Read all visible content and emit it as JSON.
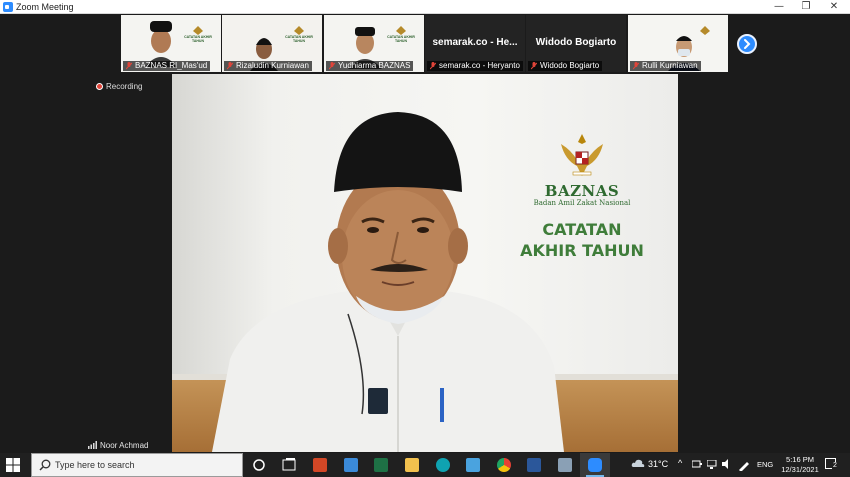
{
  "window": {
    "title": "Zoom Meeting",
    "controls": {
      "minimize": "—",
      "restore": "❐",
      "close": "✕"
    }
  },
  "thumbnails": [
    {
      "name": "BAZNAS RI_Mas'ud",
      "type": "video",
      "muted": true
    },
    {
      "name": "Rizaludin Kurniawan",
      "type": "video",
      "muted": true
    },
    {
      "name": "Yudhiarma BAZNAS",
      "type": "video",
      "muted": true
    },
    {
      "name": "semarak.co - Heryanto",
      "display_title": "semarak.co - He...",
      "type": "name-only",
      "muted": true
    },
    {
      "name": "Widodo Bogiarto",
      "display_title": "Widodo Bogiarto",
      "type": "name-only",
      "muted": true
    },
    {
      "name": "Rulli Kurniawan",
      "type": "video",
      "muted": true
    }
  ],
  "mini_logo": "CATATAN AKHIR TAHUN",
  "recording_label": "Recording",
  "main_video": {
    "speaker_name": "Noor Achmad",
    "backdrop": {
      "org": "BAZNAS",
      "org_full": "Badan Amil Zakat Nasional",
      "line1": "CATATAN",
      "line2": "AKHIR TAHUN"
    }
  },
  "taskbar": {
    "search_placeholder": "Type here to search",
    "weather": "31°C",
    "language": "ENG",
    "time": "5:16 PM",
    "date": "12/31/2021",
    "notification_count": "2",
    "tray_caret": "^",
    "apps": [
      {
        "name": "task-view",
        "color": "#ffffff"
      },
      {
        "name": "powerpoint",
        "color": "#d24726"
      },
      {
        "name": "downloads",
        "color": "#3b8ad8"
      },
      {
        "name": "excel",
        "color": "#1e7145"
      },
      {
        "name": "file-explorer",
        "color": "#f2c14e"
      },
      {
        "name": "edge",
        "color": "#0fa3b1"
      },
      {
        "name": "screen-sketch",
        "color": "#4aa3df"
      },
      {
        "name": "chrome",
        "color": "#e44134"
      },
      {
        "name": "word",
        "color": "#2b579a"
      },
      {
        "name": "photos",
        "color": "#8aa0b5"
      },
      {
        "name": "zoom",
        "color": "#2d8cff"
      }
    ]
  },
  "colors": {
    "accent": "#2d8cff",
    "brand_green": "#2f6a30",
    "recording_red": "#e0453a"
  }
}
